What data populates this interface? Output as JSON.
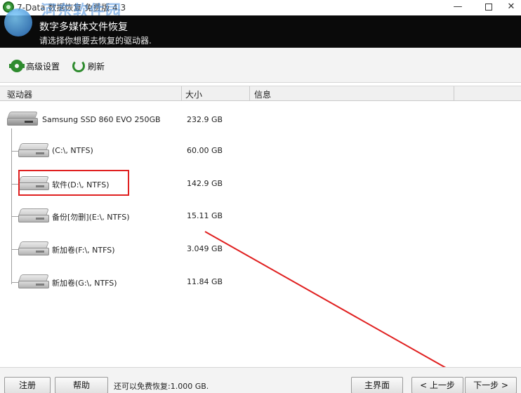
{
  "window": {
    "title": "7-Data 数据恢复 免费版 4.3",
    "watermark": "河东软件园",
    "minimize_label": "—",
    "close_label": "✕"
  },
  "header": {
    "title": "数字多媒体文件恢复",
    "subtitle": "请选择你想要去恢复的驱动器."
  },
  "toolbar": {
    "settings_label": "高级设置",
    "refresh_label": "刷新"
  },
  "table": {
    "columns": [
      "驱动器",
      "大小",
      "信息"
    ],
    "rows": [
      {
        "label": "Samsung SSD 860 EVO 250GB",
        "size": "232.9 GB",
        "icon": "ssd-drive-icon"
      },
      {
        "label": "(C:\\, NTFS)",
        "size": "60.00 GB",
        "icon": "partition-drive-icon"
      },
      {
        "label": "软件(D:\\, NTFS)",
        "size": "142.9 GB",
        "icon": "partition-drive-icon"
      },
      {
        "label": "备份[勿删](E:\\, NTFS)",
        "size": "15.11 GB",
        "icon": "partition-drive-icon"
      },
      {
        "label": "新加卷(F:\\, NTFS)",
        "size": "3.049 GB",
        "icon": "partition-drive-icon"
      },
      {
        "label": "新加卷(G:\\, NTFS)",
        "size": "11.84 GB",
        "icon": "partition-drive-icon"
      }
    ]
  },
  "footer": {
    "register_label": "注册",
    "help_label": "帮助",
    "status_text": "还可以免费恢复:1.000 GB.",
    "main_label": "主界面",
    "prev_label": "< 上一步",
    "next_label": "下一步 >"
  },
  "colors": {
    "header_bg": "#0a0a0a",
    "accent_green": "#2e8b2e",
    "highlight_red": "#e02020"
  }
}
